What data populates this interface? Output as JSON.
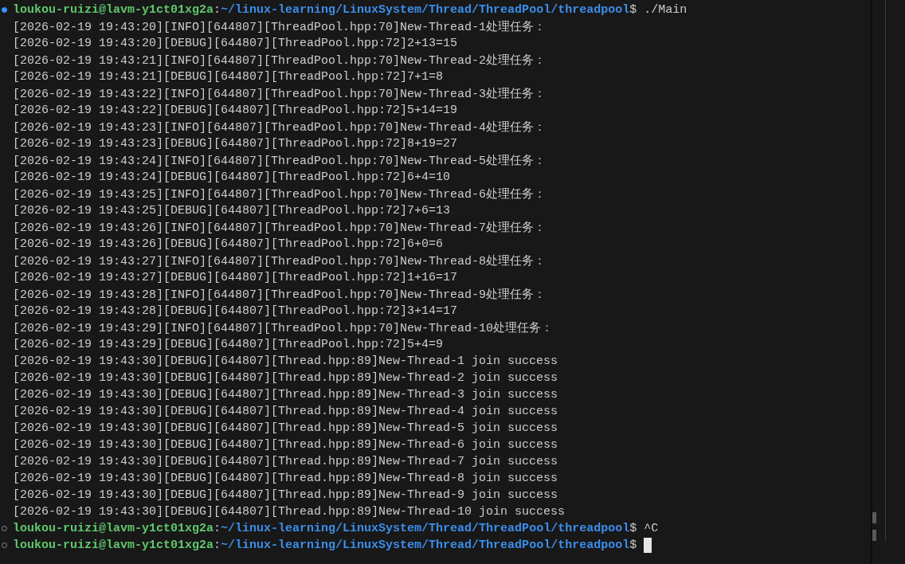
{
  "terminal": {
    "lines": [
      {
        "kind": "prompt",
        "decorated": true,
        "user": "loukou-ruizi@lavm-y1ct01xg2a",
        "separator": ":",
        "path": "~/linux-learning/LinuxSystem/Thread/ThreadPool/threadpool",
        "symbol": "$",
        "command": "./Main",
        "cursor": false
      },
      {
        "kind": "output",
        "text": "[2026-02-19 19:43:20][INFO][644807][ThreadPool.hpp:70]New-Thread-1处理任务："
      },
      {
        "kind": "output",
        "text": "[2026-02-19 19:43:20][DEBUG][644807][ThreadPool.hpp:72]2+13=15"
      },
      {
        "kind": "output",
        "text": "[2026-02-19 19:43:21][INFO][644807][ThreadPool.hpp:70]New-Thread-2处理任务："
      },
      {
        "kind": "output",
        "text": "[2026-02-19 19:43:21][DEBUG][644807][ThreadPool.hpp:72]7+1=8"
      },
      {
        "kind": "output",
        "text": "[2026-02-19 19:43:22][INFO][644807][ThreadPool.hpp:70]New-Thread-3处理任务："
      },
      {
        "kind": "output",
        "text": "[2026-02-19 19:43:22][DEBUG][644807][ThreadPool.hpp:72]5+14=19"
      },
      {
        "kind": "output",
        "text": "[2026-02-19 19:43:23][INFO][644807][ThreadPool.hpp:70]New-Thread-4处理任务："
      },
      {
        "kind": "output",
        "text": "[2026-02-19 19:43:23][DEBUG][644807][ThreadPool.hpp:72]8+19=27"
      },
      {
        "kind": "output",
        "text": "[2026-02-19 19:43:24][INFO][644807][ThreadPool.hpp:70]New-Thread-5处理任务："
      },
      {
        "kind": "output",
        "text": "[2026-02-19 19:43:24][DEBUG][644807][ThreadPool.hpp:72]6+4=10"
      },
      {
        "kind": "output",
        "text": "[2026-02-19 19:43:25][INFO][644807][ThreadPool.hpp:70]New-Thread-6处理任务："
      },
      {
        "kind": "output",
        "text": "[2026-02-19 19:43:25][DEBUG][644807][ThreadPool.hpp:72]7+6=13"
      },
      {
        "kind": "output",
        "text": "[2026-02-19 19:43:26][INFO][644807][ThreadPool.hpp:70]New-Thread-7处理任务："
      },
      {
        "kind": "output",
        "text": "[2026-02-19 19:43:26][DEBUG][644807][ThreadPool.hpp:72]6+0=6"
      },
      {
        "kind": "output",
        "text": "[2026-02-19 19:43:27][INFO][644807][ThreadPool.hpp:70]New-Thread-8处理任务："
      },
      {
        "kind": "output",
        "text": "[2026-02-19 19:43:27][DEBUG][644807][ThreadPool.hpp:72]1+16=17"
      },
      {
        "kind": "output",
        "text": "[2026-02-19 19:43:28][INFO][644807][ThreadPool.hpp:70]New-Thread-9处理任务："
      },
      {
        "kind": "output",
        "text": "[2026-02-19 19:43:28][DEBUG][644807][ThreadPool.hpp:72]3+14=17"
      },
      {
        "kind": "output",
        "text": "[2026-02-19 19:43:29][INFO][644807][ThreadPool.hpp:70]New-Thread-10处理任务："
      },
      {
        "kind": "output",
        "text": "[2026-02-19 19:43:29][DEBUG][644807][ThreadPool.hpp:72]5+4=9"
      },
      {
        "kind": "output",
        "text": "[2026-02-19 19:43:30][DEBUG][644807][Thread.hpp:89]New-Thread-1 join success"
      },
      {
        "kind": "output",
        "text": "[2026-02-19 19:43:30][DEBUG][644807][Thread.hpp:89]New-Thread-2 join success"
      },
      {
        "kind": "output",
        "text": "[2026-02-19 19:43:30][DEBUG][644807][Thread.hpp:89]New-Thread-3 join success"
      },
      {
        "kind": "output",
        "text": "[2026-02-19 19:43:30][DEBUG][644807][Thread.hpp:89]New-Thread-4 join success"
      },
      {
        "kind": "output",
        "text": "[2026-02-19 19:43:30][DEBUG][644807][Thread.hpp:89]New-Thread-5 join success"
      },
      {
        "kind": "output",
        "text": "[2026-02-19 19:43:30][DEBUG][644807][Thread.hpp:89]New-Thread-6 join success"
      },
      {
        "kind": "output",
        "text": "[2026-02-19 19:43:30][DEBUG][644807][Thread.hpp:89]New-Thread-7 join success"
      },
      {
        "kind": "output",
        "text": "[2026-02-19 19:43:30][DEBUG][644807][Thread.hpp:89]New-Thread-8 join success"
      },
      {
        "kind": "output",
        "text": "[2026-02-19 19:43:30][DEBUG][644807][Thread.hpp:89]New-Thread-9 join success"
      },
      {
        "kind": "output",
        "text": "[2026-02-19 19:43:30][DEBUG][644807][Thread.hpp:89]New-Thread-10 join success"
      },
      {
        "kind": "prompt",
        "decorated": false,
        "user": "loukou-ruizi@lavm-y1ct01xg2a",
        "separator": ":",
        "path": "~/linux-learning/LinuxSystem/Thread/ThreadPool/threadpool",
        "symbol": "$",
        "command": "^C",
        "cursor": false
      },
      {
        "kind": "prompt",
        "decorated": false,
        "user": "loukou-ruizi@lavm-y1ct01xg2a",
        "separator": ":",
        "path": "~/linux-learning/LinuxSystem/Thread/ThreadPool/threadpool",
        "symbol": "$",
        "cursor": true
      }
    ]
  }
}
